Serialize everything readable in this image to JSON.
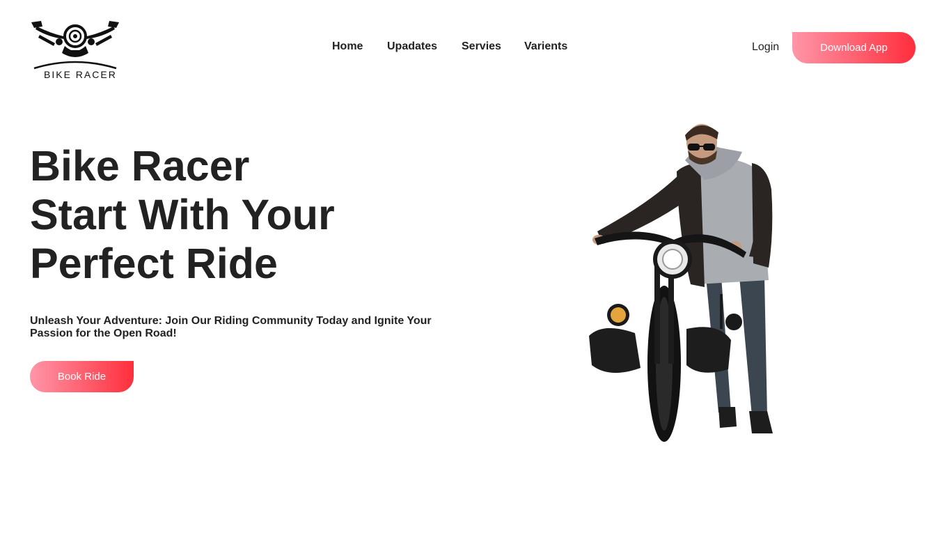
{
  "brand": {
    "name": "BIKE RACER",
    "logo_icon": "motorcycle-handlebar-icon"
  },
  "nav": {
    "items": [
      {
        "label": "Home"
      },
      {
        "label": "Upadates"
      },
      {
        "label": "Servies"
      },
      {
        "label": "Varients"
      }
    ],
    "login_label": "Login",
    "download_label": "Download App"
  },
  "hero": {
    "title_lines": [
      "Bike Racer",
      "Start With Your",
      "Perfect Ride"
    ],
    "subtitle": "Unleash Your Adventure: Join Our Riding Community Today and Ignite Your Passion for the Open Road!",
    "cta_label": "Book Ride",
    "image": "man-with-motorcycle-photo"
  },
  "colors": {
    "gradient_start": "#ff96a8",
    "gradient_end": "#ff2e3c",
    "text": "#222222",
    "background": "#ffffff"
  }
}
